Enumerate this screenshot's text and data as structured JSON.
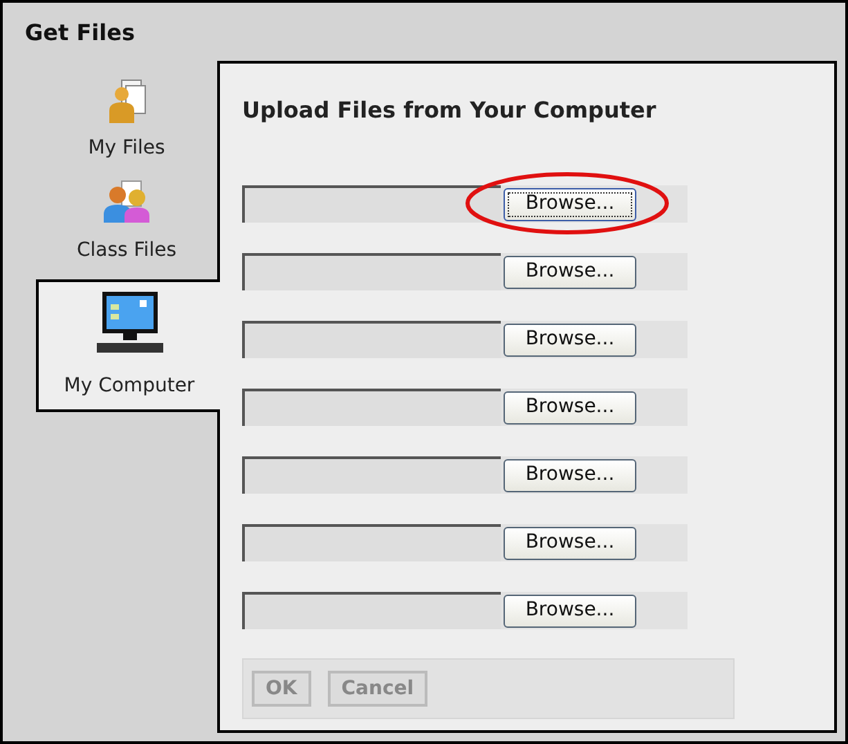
{
  "window": {
    "title": "Get Files"
  },
  "tabs": [
    {
      "label": "My Files",
      "kind": "files",
      "selected": false
    },
    {
      "label": "Class Files",
      "kind": "class",
      "selected": false
    },
    {
      "label": "My Computer",
      "kind": "computer",
      "selected": true
    }
  ],
  "panel": {
    "heading": "Upload Files from Your Computer"
  },
  "rows": [
    {
      "button": "Browse...",
      "focused": true,
      "circled": true
    },
    {
      "button": "Browse...",
      "focused": false,
      "circled": false
    },
    {
      "button": "Browse...",
      "focused": false,
      "circled": false
    },
    {
      "button": "Browse...",
      "focused": false,
      "circled": false
    },
    {
      "button": "Browse...",
      "focused": false,
      "circled": false
    },
    {
      "button": "Browse...",
      "focused": false,
      "circled": false
    },
    {
      "button": "Browse...",
      "focused": false,
      "circled": false
    }
  ],
  "buttons": [
    {
      "label": "OK",
      "disabled": true
    },
    {
      "label": "Cancel",
      "disabled": true
    }
  ]
}
